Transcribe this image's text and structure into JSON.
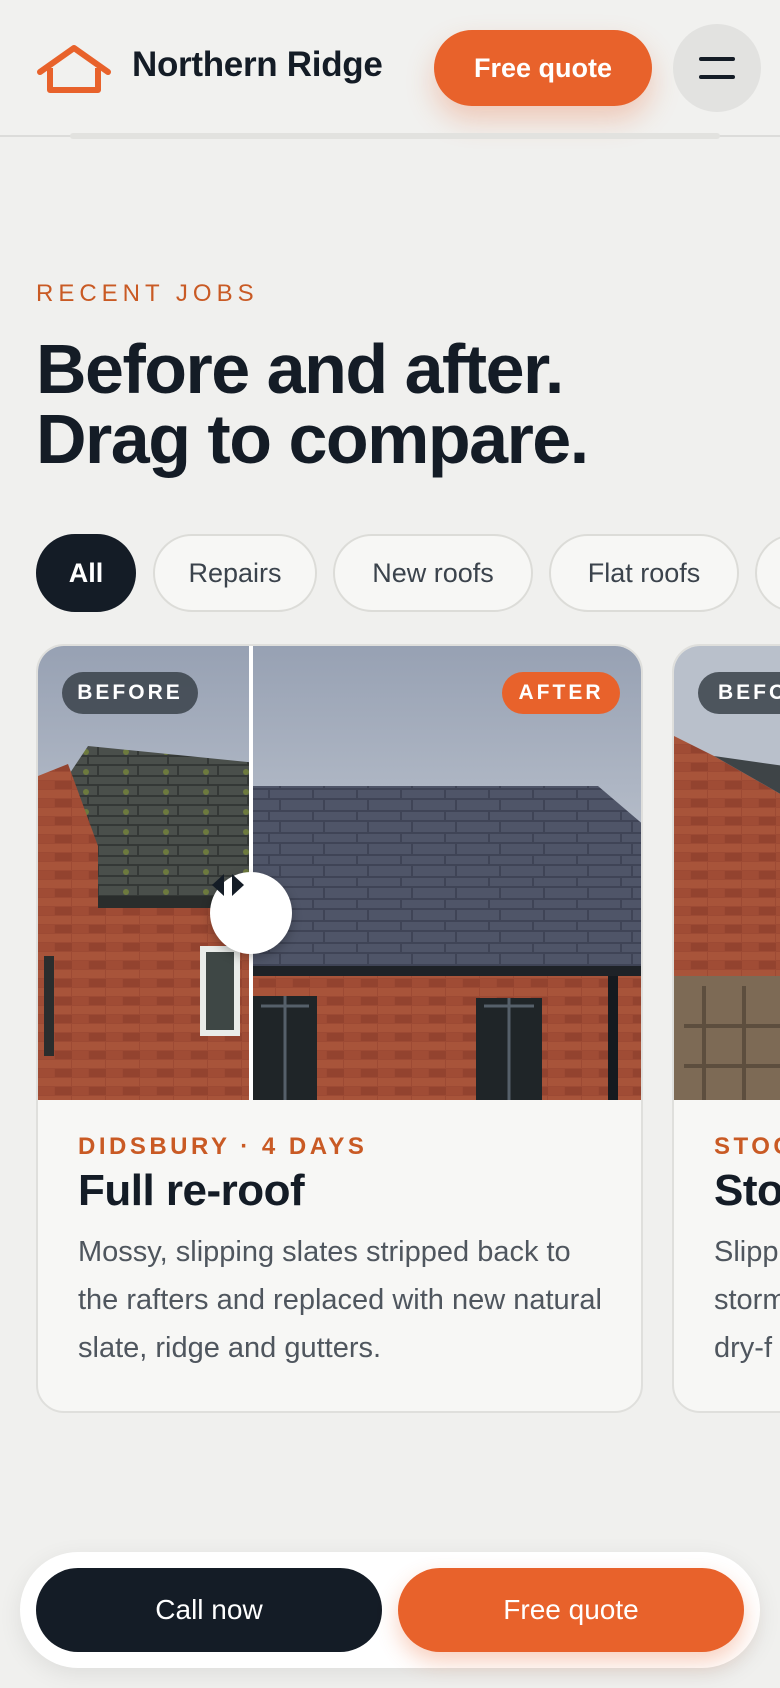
{
  "header": {
    "brand": "Northern Ridge",
    "quote_label": "Free quote",
    "logo_icon": "house-outline-icon",
    "menu_icon": "hamburger-menu-icon"
  },
  "section": {
    "eyebrow": "RECENT JOBS",
    "headline_line1": "Before and after.",
    "headline_line2": "Drag to compare."
  },
  "filters": {
    "items": [
      "All",
      "Repairs",
      "New roofs",
      "Flat roofs",
      ""
    ],
    "selected": "All"
  },
  "jobs": [
    {
      "before_label": "BEFORE",
      "after_label": "AFTER",
      "meta": "DIDSBURY · 4 DAYS",
      "title": "Full re-roof",
      "description": "Mossy, slipping slates stripped back to the rafters and replaced with new natural slate, ridge and gutters."
    },
    {
      "before_label": "BEFO",
      "meta": "STOC",
      "title": "Sto",
      "desc_line1": "Slipp",
      "desc_line2": "storm",
      "desc_line3": "dry-f"
    }
  ],
  "bottom_bar": {
    "call_label": "Call now",
    "quote_label": "Free quote"
  },
  "colors": {
    "accent": "#e8622b",
    "dark": "#141c26",
    "background": "#f0f0ee"
  }
}
